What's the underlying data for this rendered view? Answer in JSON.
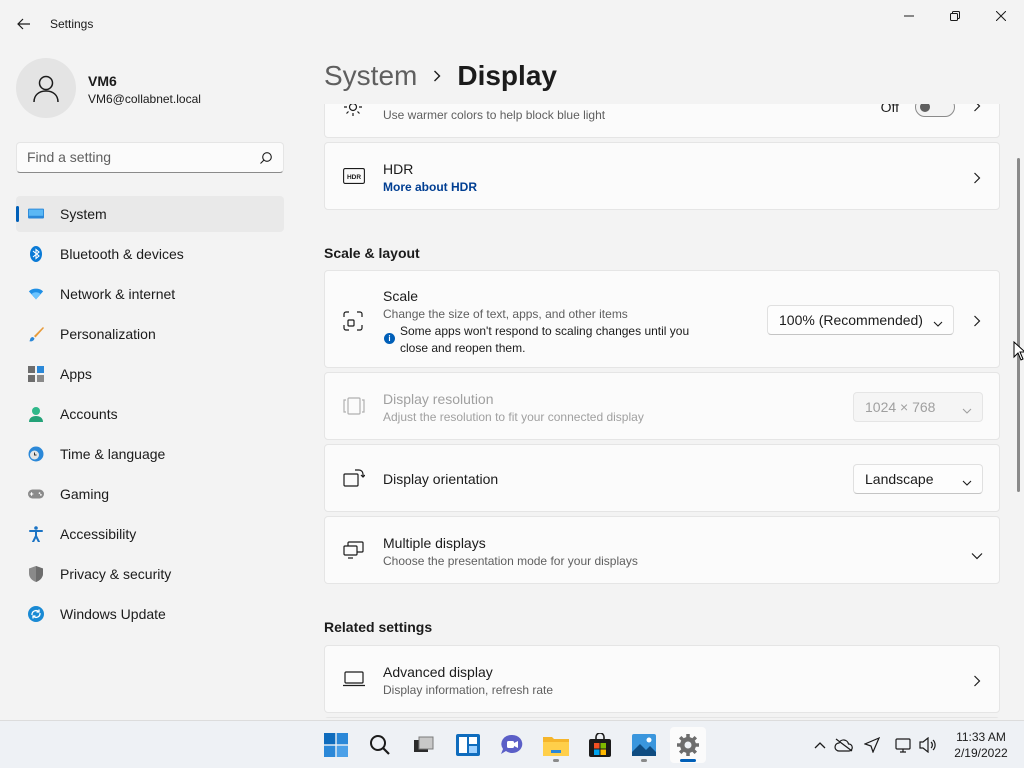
{
  "window": {
    "title": "Settings"
  },
  "profile": {
    "name": "VM6",
    "email": "VM6@collabnet.local"
  },
  "search": {
    "placeholder": "Find a setting"
  },
  "sidebar": {
    "items": [
      {
        "label": "System",
        "icon": "system-icon",
        "active": true
      },
      {
        "label": "Bluetooth & devices",
        "icon": "bluetooth-icon"
      },
      {
        "label": "Network & internet",
        "icon": "wifi-icon"
      },
      {
        "label": "Personalization",
        "icon": "brush-icon"
      },
      {
        "label": "Apps",
        "icon": "apps-icon"
      },
      {
        "label": "Accounts",
        "icon": "accounts-icon"
      },
      {
        "label": "Time & language",
        "icon": "clock-globe-icon"
      },
      {
        "label": "Gaming",
        "icon": "gamepad-icon"
      },
      {
        "label": "Accessibility",
        "icon": "accessibility-icon"
      },
      {
        "label": "Privacy & security",
        "icon": "shield-icon"
      },
      {
        "label": "Windows Update",
        "icon": "update-icon"
      }
    ]
  },
  "breadcrumb": {
    "parent": "System",
    "current": "Display"
  },
  "night_light": {
    "subtitle": "Use warmer colors to help block blue light",
    "toggle_label": "Off",
    "toggle_on": false
  },
  "hdr": {
    "title": "HDR",
    "link": "More about HDR",
    "icon_text": "HDR"
  },
  "scale_layout": {
    "heading": "Scale & layout",
    "scale": {
      "title": "Scale",
      "subtitle": "Change the size of text, apps, and other items",
      "info_line1": "Some apps won't respond to scaling changes until you",
      "info_line2": "close and reopen them.",
      "value": "100% (Recommended)"
    },
    "resolution": {
      "title": "Display resolution",
      "subtitle": "Adjust the resolution to fit your connected display",
      "value": "1024 × 768",
      "disabled": true
    },
    "orientation": {
      "title": "Display orientation",
      "value": "Landscape"
    },
    "multiple": {
      "title": "Multiple displays",
      "subtitle": "Choose the presentation mode for your displays"
    }
  },
  "related": {
    "heading": "Related settings",
    "advanced": {
      "title": "Advanced display",
      "subtitle": "Display information, refresh rate"
    }
  },
  "taskbar": {
    "apps": [
      "start-icon",
      "search-icon",
      "task-view-icon",
      "widgets-icon",
      "chat-icon",
      "file-explorer-icon",
      "store-icon",
      "photos-icon",
      "settings-icon"
    ],
    "time": "11:33 AM",
    "date": "2/19/2022"
  },
  "colors": {
    "accent": "#005fb8",
    "link": "#003e92",
    "background": "#f3f3f3",
    "card": "#fbfbfb"
  }
}
